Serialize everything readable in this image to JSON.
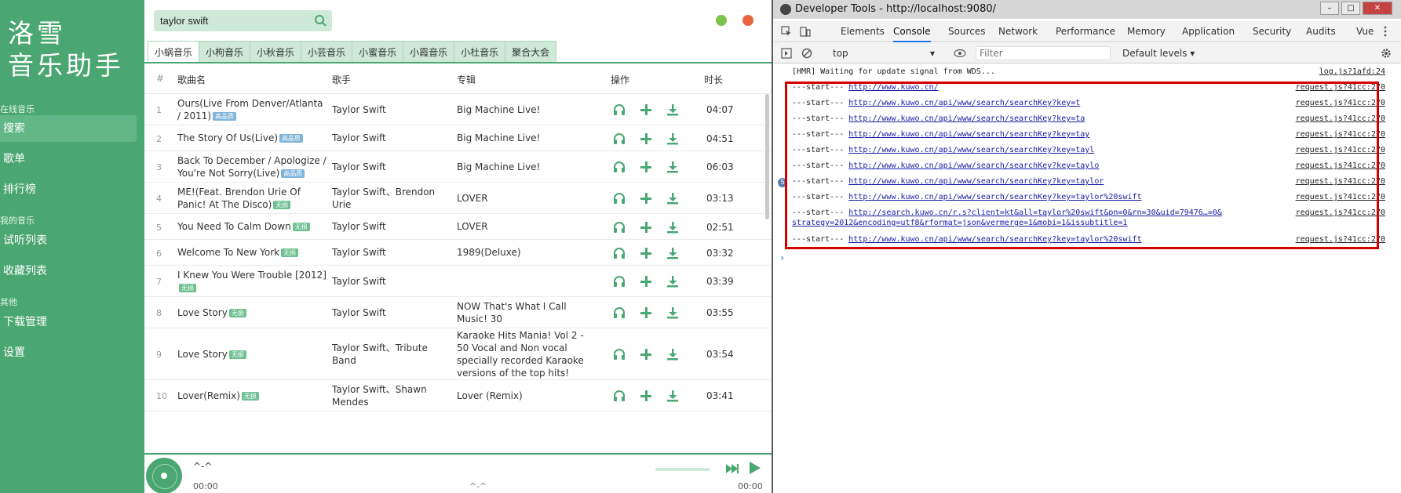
{
  "app": {
    "logo_line1": "洛雪",
    "logo_line2": "音乐助手",
    "sidebar": {
      "group_online": "在线音乐",
      "item_search": "搜索",
      "item_playlist": "歌单",
      "item_ranking": "排行榜",
      "group_mine": "我的音乐",
      "item_trial": "试听列表",
      "item_favorite": "收藏列表",
      "group_other": "其他",
      "item_download": "下载管理",
      "item_settings": "设置"
    },
    "search": {
      "value": "taylor swift"
    },
    "colors": {
      "accent": "#4aa772",
      "min_dot": "#7cc24a",
      "close_dot": "#e8633f"
    },
    "source_tabs": [
      "小蜗音乐",
      "小枸音乐",
      "小秋音乐",
      "小芸音乐",
      "小蜜音乐",
      "小霞音乐",
      "小杜音乐",
      "聚合大会"
    ],
    "active_tab": 0,
    "table": {
      "headers": {
        "num": "#",
        "name": "歌曲名",
        "singer": "歌手",
        "album": "专辑",
        "ops": "操作",
        "duration": "时长"
      },
      "rows": [
        {
          "num": "1",
          "name": "Ours(Live From Denver/Atlanta / 2011)",
          "badge": "高品质",
          "badge_type": "hq",
          "singer": "Taylor Swift",
          "album": "Big Machine Live!",
          "duration": "04:07"
        },
        {
          "num": "2",
          "name": "The Story Of Us(Live)",
          "badge": "高品质",
          "badge_type": "hq",
          "singer": "Taylor Swift",
          "album": "Big Machine Live!",
          "duration": "04:51"
        },
        {
          "num": "3",
          "name": "Back To December / Apologize / You're Not Sorry(Live)",
          "badge": "高品质",
          "badge_type": "hq",
          "singer": "Taylor Swift",
          "album": "Big Machine Live!",
          "duration": "06:03"
        },
        {
          "num": "4",
          "name": "ME!(Feat. Brendon Urie Of Panic! At The Disco)",
          "badge": "无损",
          "badge_type": "lossless",
          "singer": "Taylor Swift、Brendon Urie",
          "album": "LOVER",
          "duration": "03:13"
        },
        {
          "num": "5",
          "name": "You Need To Calm Down",
          "badge": "无损",
          "badge_type": "lossless",
          "singer": "Taylor Swift",
          "album": "LOVER",
          "duration": "02:51"
        },
        {
          "num": "6",
          "name": "Welcome To New York",
          "badge": "无损",
          "badge_type": "lossless",
          "singer": "Taylor Swift",
          "album": "1989(Deluxe)",
          "duration": "03:32"
        },
        {
          "num": "7",
          "name": "I Knew You Were Trouble [2012]",
          "badge": "无损",
          "badge_type": "lossless",
          "singer": "Taylor Swift",
          "album": "",
          "duration": "03:39"
        },
        {
          "num": "8",
          "name": "Love Story",
          "badge": "无损",
          "badge_type": "lossless",
          "singer": "Taylor Swift",
          "album": "NOW That's What I Call Music! 30",
          "duration": "03:55"
        },
        {
          "num": "9",
          "name": "Love Story",
          "badge": "无损",
          "badge_type": "lossless",
          "singer": "Taylor Swift、Tribute Band",
          "album": "Karaoke Hits Mania! Vol 2 - 50 Vocal and Non vocal specially recorded Karaoke versions of the top hits!",
          "duration": "03:54"
        },
        {
          "num": "10",
          "name": "Lover(Remix)",
          "badge": "无损",
          "badge_type": "lossless",
          "singer": "Taylor Swift、Shawn Mendes",
          "album": "Lover (Remix)",
          "duration": "03:41"
        }
      ]
    },
    "player": {
      "title": "^-^",
      "current_time": "00:00",
      "center_text": "^-^",
      "total_time": "00:00"
    }
  },
  "devtools": {
    "title": "Developer Tools - http://localhost:9080/",
    "tabs": [
      "Elements",
      "Console",
      "Sources",
      "Network",
      "Performance",
      "Memory",
      "Application",
      "Security",
      "Audits",
      "Vue"
    ],
    "active_tab": 1,
    "context": "top",
    "filter_placeholder": "Filter",
    "levels": "Default levels ▾",
    "hmr_line": "[HMR] Waiting for update signal from WDS...",
    "hmr_src": "log.js?1afd:24",
    "logs": [
      {
        "prefix": "---start---",
        "url": "http://www.kuwo.cn/",
        "src": "request.js?41cc:270"
      },
      {
        "prefix": "---start---",
        "url": "http://www.kuwo.cn/api/www/search/searchKey?key=t",
        "src": "request.js?41cc:270"
      },
      {
        "prefix": "---start---",
        "url": "http://www.kuwo.cn/api/www/search/searchKey?key=ta",
        "src": "request.js?41cc:270"
      },
      {
        "prefix": "---start---",
        "url": "http://www.kuwo.cn/api/www/search/searchKey?key=tay",
        "src": "request.js?41cc:270"
      },
      {
        "prefix": "---start---",
        "url": "http://www.kuwo.cn/api/www/search/searchKey?key=tayl",
        "src": "request.js?41cc:270"
      },
      {
        "prefix": "---start---",
        "url": "http://www.kuwo.cn/api/www/search/searchKey?key=taylo",
        "src": "request.js?41cc:270"
      },
      {
        "prefix": "---start---",
        "url": "http://www.kuwo.cn/api/www/search/searchKey?key=taylor",
        "src": "request.js?41cc:270",
        "count": "5"
      },
      {
        "prefix": "---start---",
        "url": "http://www.kuwo.cn/api/www/search/searchKey?key=taylor%20swift",
        "src": "request.js?41cc:270"
      },
      {
        "prefix": "---start---",
        "url": "http://search.kuwo.cn/r.s?client=kt&all=taylor%20swift&pn=0&rn=30&uid=79476…=0&",
        "url2": "strategy=2012&encoding=utf8&rformat=json&vermerge=1&mobi=1&issubtitle=1",
        "src": "request.js?41cc:270"
      },
      {
        "prefix": "---start---",
        "url": "http://www.kuwo.cn/api/www/search/searchKey?key=taylor%20swift",
        "src": "request.js?41cc:270"
      }
    ],
    "prompt": "›"
  }
}
